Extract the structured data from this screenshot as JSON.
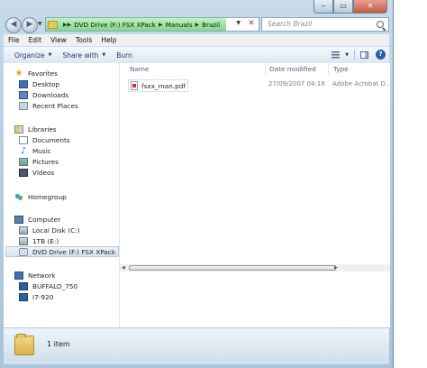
{
  "address": {
    "crumbs": [
      "DVD Drive (F:) FSX XPack",
      "Manuals",
      "Brazil"
    ]
  },
  "search": {
    "placeholder": "Search Brazil"
  },
  "menu": [
    "File",
    "Edit",
    "View",
    "Tools",
    "Help"
  ],
  "toolbar": {
    "organize": "Organize",
    "share_with": "Share with",
    "burn": "Burn"
  },
  "nav": {
    "favorites": {
      "label": "Favorites",
      "items": [
        "Desktop",
        "Downloads",
        "Recent Places"
      ]
    },
    "libraries": {
      "label": "Libraries",
      "items": [
        "Documents",
        "Music",
        "Pictures",
        "Videos"
      ]
    },
    "homegroup": {
      "label": "Homegroup"
    },
    "computer": {
      "label": "Computer",
      "items": [
        "Local Disk (C:)",
        "1TB (E:)",
        "DVD Drive (F:) FSX XPack"
      ]
    },
    "network": {
      "label": "Network",
      "items": [
        "BUFFALO_750",
        "I7-920"
      ]
    }
  },
  "columns": {
    "name": "Name",
    "date": "Date modified",
    "type": "Type"
  },
  "files": [
    {
      "name": "fsxx_man.pdf",
      "date": "27/09/2007 04:18",
      "type": "Adobe Acrobat D..."
    }
  ],
  "status": {
    "count": "1 item"
  }
}
